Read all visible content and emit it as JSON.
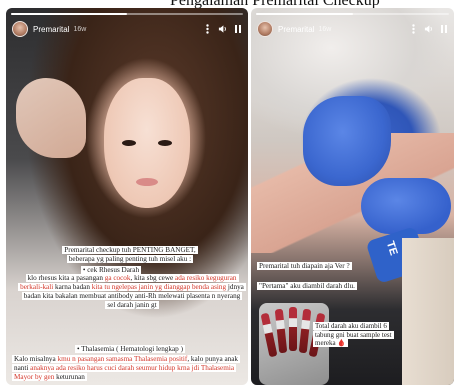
{
  "top_strip_text": "Pengalaman Premarital Checkup",
  "left_story": {
    "username": "Premarital",
    "time": "16w",
    "progress": 0.5,
    "text": {
      "intro_line1": "Premarital checkup tuh PENTING BANGET,",
      "intro_line2": "beberapa yg paling penting tuh misel aku :",
      "rhesus_heading": "• cek Rhesus Darah",
      "rhesus_p1": "klo rhesus kita a pasangan ",
      "rhesus_red1": "ga cocok",
      "rhesus_p2": ", kita sbg cewe ",
      "rhesus_red2": "ada resiko keguguran berkali-kali",
      "rhesus_p3": " karna badan ",
      "rhesus_red3": "kita tu ngelepas janin yg dianggap benda asing",
      "rhesus_p4": " jdnya badan kita bakalan membuat antibody anti-Rh melewati plasenta n nyerang sel darah janin gt",
      "thal_heading": "• Thalasemia ( Hematologi lengkap )",
      "thal_p1": "Kalo misalnya ",
      "thal_red1": "kmu n pasangan samasma Thalasemia positif",
      "thal_p2": ", kalo punya anak nanti ",
      "thal_red2": "anaknya ada resiko harus cuci darah seumur hidup krna jdi Thalasemia Mayor by gen",
      "thal_p3": " keturunan"
    }
  },
  "right_story": {
    "username": "Premarital",
    "time": "16w",
    "progress": 0.5,
    "wristband_text": "TE",
    "text": {
      "line1": "Premarital tuh diapain aja Ver ?",
      "line2_a": "Pertama",
      "line2_b": " aku diambil darah dlu.",
      "caption": "Total darah aku diambil 6 tabung gni buat sample test mereka 🩸"
    }
  },
  "icons": [
    "more-icon",
    "speaker-icon",
    "volume-icon"
  ]
}
